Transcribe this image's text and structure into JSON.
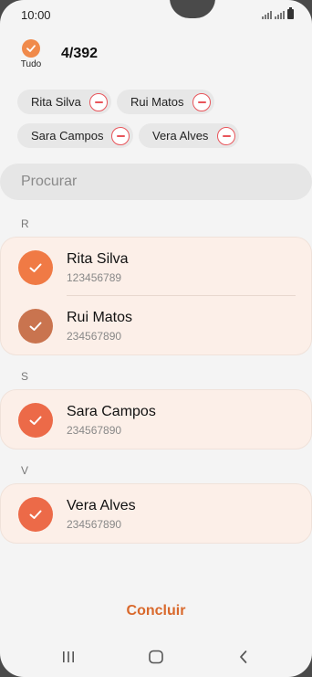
{
  "status_bar": {
    "time": "10:00"
  },
  "header": {
    "select_all_label": "Tudo",
    "selected_count": "4/392"
  },
  "chips": [
    {
      "label": "Rita Silva"
    },
    {
      "label": "Rui Matos"
    },
    {
      "label": "Sara Campos"
    },
    {
      "label": "Vera Alves"
    }
  ],
  "search": {
    "placeholder": "Procurar"
  },
  "sections": [
    {
      "letter": "R",
      "contacts": [
        {
          "name": "Rita Silva",
          "number": "123456789"
        },
        {
          "name": "Rui Matos",
          "number": "234567890"
        }
      ]
    },
    {
      "letter": "S",
      "contacts": [
        {
          "name": "Sara Campos",
          "number": "234567890"
        }
      ]
    },
    {
      "letter": "V",
      "contacts": [
        {
          "name": "Vera Alves",
          "number": "234567890"
        }
      ]
    }
  ],
  "footer": {
    "done_label": "Concluir"
  },
  "colors": {
    "accent": "#d9692c",
    "check_fill": "#f07a45",
    "card_bg": "#fcefe8",
    "chip_remove": "#e8555b"
  }
}
